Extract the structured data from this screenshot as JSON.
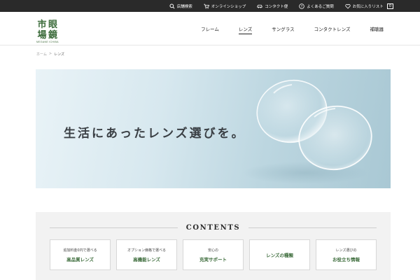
{
  "topbar": {
    "items": [
      {
        "label": "店舗検索",
        "icon": "search-icon"
      },
      {
        "label": "オンラインショップ",
        "icon": "cart-icon"
      },
      {
        "label": "コンタクト便",
        "icon": "car-icon"
      },
      {
        "label": "よくあるご質問",
        "icon": "question-icon"
      },
      {
        "label": "お気に入りリスト",
        "icon": "heart-icon",
        "count": "0"
      }
    ]
  },
  "logo": {
    "text": "市眼場鏡",
    "sub": "MEGANE ICHIBA"
  },
  "nav": {
    "items": [
      {
        "label": "フレーム"
      },
      {
        "label": "レンズ",
        "active": true
      },
      {
        "label": "サングラス"
      },
      {
        "label": "コンタクトレンズ"
      },
      {
        "label": "補聴器"
      }
    ]
  },
  "breadcrumb": {
    "home": "ホーム",
    "separator": ">",
    "current": "レンズ"
  },
  "hero": {
    "headline": "生活にあったレンズ選びを。"
  },
  "contents": {
    "title": "CONTENTS",
    "cards": [
      {
        "sub": "追加料金0円で選べる",
        "main": "高品質レンズ"
      },
      {
        "sub": "オプション価格で選べる",
        "main": "高機能レンズ"
      },
      {
        "sub": "安心の",
        "main": "充実サポート"
      },
      {
        "sub": "",
        "main": "レンズの種類"
      },
      {
        "sub": "レンズ選びの",
        "main": "お役立ち情報"
      }
    ]
  },
  "colors": {
    "brand_green": "#3b6b3a",
    "topbar_bg": "#2a2a2a",
    "contents_bg": "#f2f2f2"
  }
}
